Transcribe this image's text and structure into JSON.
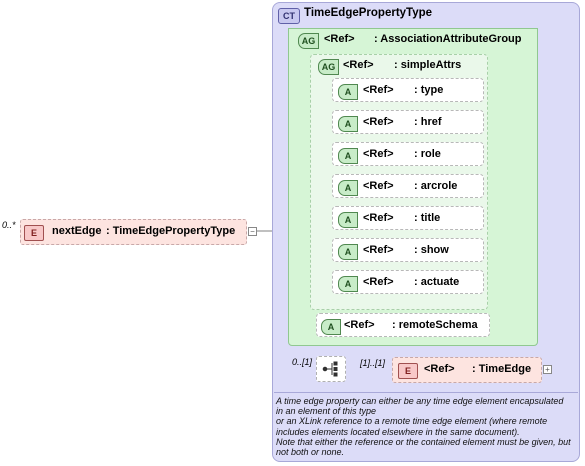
{
  "root_element": {
    "occurs": "0..*",
    "badge": "E",
    "name": "nextEdge",
    "type": ": TimeEdgePropertyType"
  },
  "complex_type": {
    "badge": "CT",
    "name": "TimeEdgePropertyType"
  },
  "association_group": {
    "badge": "AG",
    "ref": "<Ref>",
    "name": ": AssociationAttributeGroup"
  },
  "simple_attrs": {
    "badge": "AG",
    "ref": "<Ref>",
    "name": ": simpleAttrs"
  },
  "attributes": [
    {
      "badge": "A",
      "ref": "<Ref>",
      "name": ": type"
    },
    {
      "badge": "A",
      "ref": "<Ref>",
      "name": ": href"
    },
    {
      "badge": "A",
      "ref": "<Ref>",
      "name": ": role"
    },
    {
      "badge": "A",
      "ref": "<Ref>",
      "name": ": arcrole"
    },
    {
      "badge": "A",
      "ref": "<Ref>",
      "name": ": title"
    },
    {
      "badge": "A",
      "ref": "<Ref>",
      "name": ": show"
    },
    {
      "badge": "A",
      "ref": "<Ref>",
      "name": ": actuate"
    }
  ],
  "remote_schema": {
    "badge": "A",
    "ref": "<Ref>",
    "name": ": remoteSchema"
  },
  "sequence": {
    "occurs": "0..[1]"
  },
  "child_element": {
    "occurs": "[1]..[1]",
    "badge": "E",
    "ref": "<Ref>",
    "name": ": TimeEdge"
  },
  "documentation": [
    "A time edge property can either be any time edge element encapsulated",
    "in an element of this type",
    "or an XLink reference to a remote time edge element (where remote",
    "includes elements located elsewhere in the same document).",
    "Note that either the reference or the contained element must be given, but",
    "not both or none."
  ]
}
